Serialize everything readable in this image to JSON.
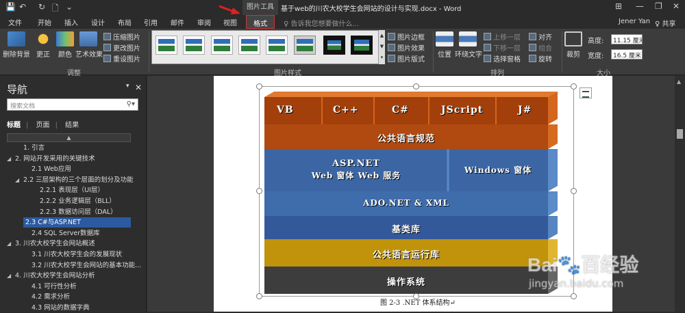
{
  "window": {
    "context_tab_group": "图片工具",
    "title": "基于web的川农大校学生会网站的设计与实现.docx - Word",
    "controls": {
      "ribbon_opts": "⊞",
      "minimize": "—",
      "restore": "❐",
      "close": "✕"
    }
  },
  "quick_access": {
    "save": "💾",
    "undo": "↶",
    "redo": "↻",
    "new": "🗋",
    "customize": "⌄"
  },
  "tabs": [
    "文件",
    "开始",
    "插入",
    "设计",
    "布局",
    "引用",
    "邮件",
    "审阅",
    "视图",
    "格式"
  ],
  "active_tab": "格式",
  "tell_me": "♀ 告诉我您想要做什么...",
  "user": "Jener Yan",
  "share": "♀ 共享",
  "ribbon": {
    "adjust": {
      "remove_bg": "删除背景",
      "corrections": "更正",
      "color": "颜色",
      "artistic": "艺术效果",
      "compress": "压缩图片",
      "change": "更改图片",
      "reset": "重设图片",
      "group": "调整"
    },
    "styles": {
      "border": "图片边框",
      "effects": "图片效果",
      "layout": "图片版式",
      "group": "图片样式",
      "scroll_up": "▲",
      "scroll_down": "▼",
      "more": "▾"
    },
    "arrange": {
      "position": "位置",
      "wrap": "环绕文字",
      "forward": "上移一层",
      "backward": "下移一层",
      "selection": "选择窗格",
      "align": "对齐",
      "group_btn": "组合",
      "rotate": "旋转",
      "group": "排列"
    },
    "size": {
      "crop": "裁剪",
      "height_label": "高度:",
      "height_value": "11.15 厘米",
      "width_label": "宽度:",
      "width_value": "16.5 厘米",
      "group": "大小"
    }
  },
  "navigation": {
    "title": "导航",
    "search_placeholder": "搜索文档",
    "views": [
      "标题",
      "页面",
      "结果"
    ],
    "collapse": "▲",
    "items": [
      {
        "text": "1. 引言",
        "level": 1,
        "expander": ""
      },
      {
        "text": "2. 网站开发采用的关键技术",
        "level": 0,
        "expander": "◢"
      },
      {
        "text": "2.1 Web应用",
        "level": 2,
        "expander": ""
      },
      {
        "text": "2.2 三层架构的三个层面的划分及功能",
        "level": 1,
        "expander": "◢"
      },
      {
        "text": "2.2.1 表现层（UI层）",
        "level": 3,
        "expander": ""
      },
      {
        "text": "2.2.2 业务逻辑层（BLL）",
        "level": 3,
        "expander": ""
      },
      {
        "text": "2.2.3 数据访问层（DAL）",
        "level": 3,
        "expander": ""
      },
      {
        "text": "2.3 C#与ASP.NET",
        "level": 2,
        "expander": "",
        "selected": true
      },
      {
        "text": "2.4 SQL Server数据库",
        "level": 2,
        "expander": ""
      },
      {
        "text": "3. 川农大校学生会网站概述",
        "level": 0,
        "expander": "◢"
      },
      {
        "text": "3.1 川农大校学生会的发展现状",
        "level": 2,
        "expander": ""
      },
      {
        "text": "3.2 川农大校学生会网站的基本功能...",
        "level": 2,
        "expander": ""
      },
      {
        "text": "4. 川农大校学生会网站分析",
        "level": 0,
        "expander": "◢"
      },
      {
        "text": "4.1 可行性分析",
        "level": 2,
        "expander": ""
      },
      {
        "text": "4.2 需求分析",
        "level": 2,
        "expander": ""
      },
      {
        "text": "4.3 网站的数据字典",
        "level": 2,
        "expander": ""
      }
    ]
  },
  "figure": {
    "languages": [
      "VB",
      "C++",
      "C#",
      "JScript",
      "J#"
    ],
    "cls": "公共语言规范",
    "aspnet_title": "ASP.NET",
    "aspnet_sub": "Web 窗体   Web 服务",
    "windows_forms": "Windows 窗体",
    "adonet": "ADO.NET & XML",
    "base_lib": "基类库",
    "clr": "公共语言运行库",
    "os": "操作系统",
    "caption": "图 2-3   .NET 体系结构↵",
    "colors": {
      "orange": "#b8470e",
      "blue": "#3a6aa9",
      "yellow": "#c89a0c",
      "dark": "#3a3a3a"
    }
  },
  "watermark": {
    "brand": "Bai🐾百经验",
    "url": "jingyan.baidu.com"
  }
}
